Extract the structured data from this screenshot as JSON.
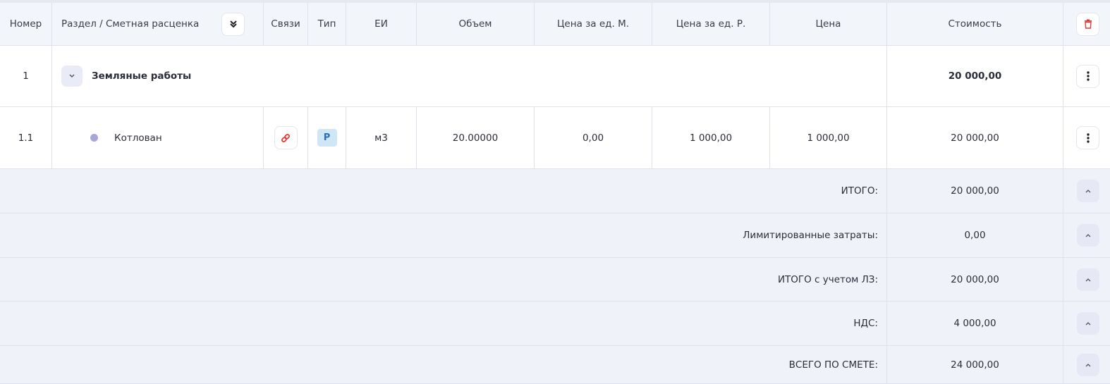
{
  "header": {
    "col_number": "Номер",
    "col_section": "Раздел / Сметная расценка",
    "col_links": "Связи",
    "col_type": "Тип",
    "col_unit": "ЕИ",
    "col_volume": "Объем",
    "col_price_m": "Цена за ед. М.",
    "col_price_r": "Цена за ед. Р.",
    "col_price": "Цена",
    "col_cost": "Стоимость"
  },
  "section": {
    "number": "1",
    "name": "Земляные работы",
    "cost": "20 000,00"
  },
  "item": {
    "number": "1.1",
    "name": "Котлован",
    "type": "Р",
    "unit": "м3",
    "volume": "20.00000",
    "price_m": "0,00",
    "price_r": "1 000,00",
    "price": "1 000,00",
    "cost": "20 000,00"
  },
  "summary": [
    {
      "label": "ИТОГО:",
      "value": "20 000,00"
    },
    {
      "label": "Лимитированные затраты:",
      "value": "0,00"
    },
    {
      "label": "ИТОГО с учетом ЛЗ:",
      "value": "20 000,00"
    },
    {
      "label": "НДС:",
      "value": "4 000,00"
    },
    {
      "label": "ВСЕГО ПО СМЕТЕ:",
      "value": "24 000,00"
    }
  ],
  "colors": {
    "accent_red": "#e53935",
    "badge_blue": "#cfe6f7",
    "dot": "#a6a6d8"
  },
  "icons": {
    "delete": "trash-icon",
    "collapse_all": "double-chevron-down-icon",
    "expand_row": "chevron-down-icon",
    "row_menu": "kebab-menu-icon",
    "link": "link-icon",
    "summary_toggle": "chevron-up-icon"
  }
}
